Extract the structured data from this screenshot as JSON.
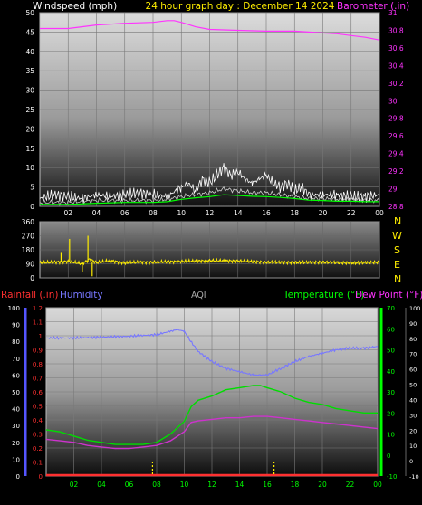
{
  "header": {
    "left_label": "Windspeed (mph)",
    "center_label": "24 hour graph day : December 14 2024",
    "right_label": "Barometer (.in)"
  },
  "colors": {
    "wind": "#ffffff",
    "gust": "#d0d0d0",
    "wind_avg": "#00ff00",
    "barometer": "#ff33ff",
    "direction": "#ffee00",
    "rain": "#ff3030",
    "humidity": "#7777ff",
    "temperature": "#00dd00",
    "dewpoint": "#cc33cc",
    "aqi": "#aaaaaa",
    "axis_green": "#00ff00",
    "axis_blue": "#5555ff",
    "axis_magenta": "#ff33ff"
  },
  "panel3_labels": {
    "rainfall": "Rainfall (.in)",
    "humidity": "Humidity",
    "aqi": "AQI",
    "temperature": "Temperature (°F)",
    "dewpoint": "Dew Point (°F)"
  },
  "compass": [
    "N",
    "W",
    "S",
    "E",
    "N"
  ],
  "chart_data": [
    {
      "type": "line",
      "name": "wind_barometer",
      "x_ticks": [
        "02",
        "04",
        "06",
        "08",
        "10",
        "12",
        "14",
        "16",
        "18",
        "20",
        "22",
        "00"
      ],
      "xlim": [
        0,
        24
      ],
      "y_left": {
        "label": "Windspeed (mph)",
        "ticks": [
          0,
          5,
          10,
          15,
          20,
          25,
          30,
          35,
          40,
          45,
          50
        ],
        "ylim": [
          0,
          50
        ]
      },
      "y_right": {
        "label": "Barometer (.in)",
        "ticks": [
          "28.8",
          "29",
          "29.2",
          "29.4",
          "29.6",
          "29.8",
          "30",
          "30.2",
          "30.4",
          "30.6",
          "30.8",
          "31"
        ],
        "ylim": [
          28.8,
          31.0
        ]
      },
      "series": [
        {
          "name": "Barometer",
          "axis": "right",
          "x": [
            0,
            2,
            4,
            6,
            8,
            9,
            9.5,
            10,
            11,
            12,
            14,
            16,
            18,
            19,
            20,
            21,
            22,
            23,
            24
          ],
          "y": [
            30.82,
            30.82,
            30.86,
            30.88,
            30.89,
            30.91,
            30.91,
            30.89,
            30.84,
            30.81,
            30.8,
            30.79,
            30.79,
            30.78,
            30.77,
            30.76,
            30.74,
            30.72,
            30.69
          ]
        },
        {
          "name": "Wind gust",
          "axis": "left",
          "x": [
            0,
            1,
            2,
            3,
            4,
            5,
            6,
            7,
            8,
            9,
            10,
            10.5,
            11,
            11.5,
            12,
            12.5,
            13,
            13.5,
            14,
            14.5,
            15,
            15.5,
            16,
            16.5,
            17,
            17.5,
            18,
            18.5,
            19,
            20,
            21,
            22,
            23,
            24
          ],
          "y": [
            2,
            3,
            2.5,
            2,
            3,
            2.5,
            3,
            3.5,
            3,
            2.5,
            5,
            6,
            4,
            7,
            6,
            8,
            10,
            8,
            9,
            7,
            6,
            7,
            8,
            6,
            5,
            6,
            4,
            5,
            3,
            3,
            3,
            2.5,
            2.5,
            3
          ]
        },
        {
          "name": "Wind speed",
          "axis": "left",
          "x": [
            0,
            2,
            4,
            6,
            8,
            9,
            10,
            11,
            12,
            13,
            14,
            15,
            16,
            17,
            18,
            19,
            20,
            21,
            22,
            23,
            24
          ],
          "y": [
            1,
            1,
            1.5,
            1.5,
            1.5,
            1.8,
            2.5,
            3,
            3.5,
            4.5,
            4,
            3.5,
            3.5,
            3,
            2.5,
            2,
            2,
            1.8,
            1.8,
            1.5,
            1.5
          ]
        },
        {
          "name": "Wind average",
          "axis": "left",
          "x": [
            0,
            2,
            4,
            6,
            8,
            9,
            10,
            11,
            12,
            13,
            14,
            15,
            16,
            17,
            18,
            19,
            20,
            21,
            22,
            23,
            24
          ],
          "y": [
            0.5,
            0.5,
            0.8,
            1,
            1,
            1.2,
            1.8,
            2.2,
            2.5,
            3,
            2.8,
            2.6,
            2.5,
            2.3,
            2,
            1.6,
            1.5,
            1.3,
            1.3,
            1.2,
            1.2
          ]
        }
      ]
    },
    {
      "type": "line",
      "name": "wind_direction",
      "x_ticks": [],
      "xlim": [
        0,
        24
      ],
      "y_left": {
        "ticks": [
          0,
          90,
          180,
          270,
          360
        ],
        "ylim": [
          0,
          360
        ]
      },
      "series": [
        {
          "name": "Wind direction",
          "x": [
            0,
            1,
            2,
            3,
            3.5,
            4,
            5,
            6,
            7,
            8,
            10,
            12,
            14,
            16,
            18,
            20,
            22,
            24
          ],
          "y": [
            95,
            100,
            105,
            90,
            120,
            98,
            110,
            95,
            100,
            100,
            105,
            110,
            108,
            100,
            98,
            100,
            95,
            100
          ]
        }
      ],
      "spikes": [
        {
          "x": 2.1,
          "y": 250
        },
        {
          "x": 3.4,
          "y": 270
        },
        {
          "x": 3.7,
          "y": 10
        },
        {
          "x": 1.5,
          "y": 160
        },
        {
          "x": 3.0,
          "y": 40
        }
      ]
    },
    {
      "type": "line",
      "name": "rain_humidity_temperature",
      "x_ticks": [
        "02",
        "04",
        "06",
        "08",
        "10",
        "12",
        "14",
        "16",
        "18",
        "20",
        "22",
        "00"
      ],
      "xlim": [
        0,
        24
      ],
      "y_rain": {
        "label": "Rainfall (.in)",
        "ticks": [
          "0",
          "0.1",
          "0.2",
          "0.3",
          "0.4",
          "0.5",
          "0.6",
          "0.7",
          "0.8",
          "0.9",
          "1",
          "1.1",
          "1.2"
        ],
        "ylim": [
          0,
          1.2
        ]
      },
      "y_humidity": {
        "label": "Humidity",
        "ticks": [
          0,
          10,
          20,
          30,
          40,
          50,
          60,
          70,
          80,
          90,
          100
        ],
        "ylim": [
          0,
          100
        ]
      },
      "y_temp": {
        "label": "Temperature (°F)",
        "ticks": [
          -10,
          0,
          10,
          20,
          30,
          40,
          50,
          60,
          70
        ],
        "ylim": [
          -10,
          70
        ]
      },
      "y_dew": {
        "label": "Dew Point (°F)",
        "ticks": [
          -10,
          0,
          10,
          20,
          30,
          40,
          50,
          60,
          70,
          80,
          90,
          100
        ],
        "ylim": [
          -10,
          100
        ]
      },
      "series": [
        {
          "name": "Humidity",
          "axis": "humidity",
          "x": [
            0,
            2,
            4,
            6,
            8,
            9,
            9.5,
            10,
            10.3,
            11,
            12,
            13,
            14,
            15,
            15.5,
            16,
            17,
            18,
            19,
            20,
            21,
            22,
            23,
            24
          ],
          "y": [
            82,
            82,
            82.5,
            83,
            84,
            86,
            87,
            86,
            82,
            74,
            68,
            64,
            62,
            60,
            60,
            60,
            64,
            68,
            71,
            73,
            75,
            76,
            76,
            77
          ]
        },
        {
          "name": "Temperature",
          "axis": "temp",
          "x": [
            0,
            1,
            2,
            3,
            4,
            5,
            6,
            7,
            8,
            9,
            10,
            10.5,
            11,
            12,
            13,
            14,
            15,
            15.5,
            16,
            17,
            18,
            19,
            20,
            21,
            22,
            23,
            24
          ],
          "y": [
            12,
            11,
            9,
            7,
            6,
            5,
            5,
            5,
            6,
            10,
            16,
            23,
            26,
            28,
            31,
            32,
            33,
            33,
            32,
            30,
            27,
            25,
            24,
            22,
            21,
            20,
            20
          ]
        },
        {
          "name": "Dew point",
          "axis": "dew",
          "x": [
            0,
            1,
            2,
            3,
            4,
            5,
            6,
            7,
            8,
            9,
            10,
            10.5,
            11,
            12,
            13,
            14,
            15,
            16,
            17,
            18,
            19,
            20,
            21,
            22,
            23,
            24
          ],
          "y": [
            14,
            13,
            12,
            10,
            9,
            8,
            8,
            9,
            10,
            13,
            19,
            25,
            26,
            27,
            28,
            28,
            29,
            29,
            28,
            27,
            26,
            25,
            24,
            23,
            22,
            21
          ]
        },
        {
          "name": "Rainfall",
          "axis": "rain",
          "x": [
            0,
            24
          ],
          "y": [
            0,
            0
          ]
        }
      ],
      "markers": [
        7.7,
        16.5
      ]
    }
  ]
}
